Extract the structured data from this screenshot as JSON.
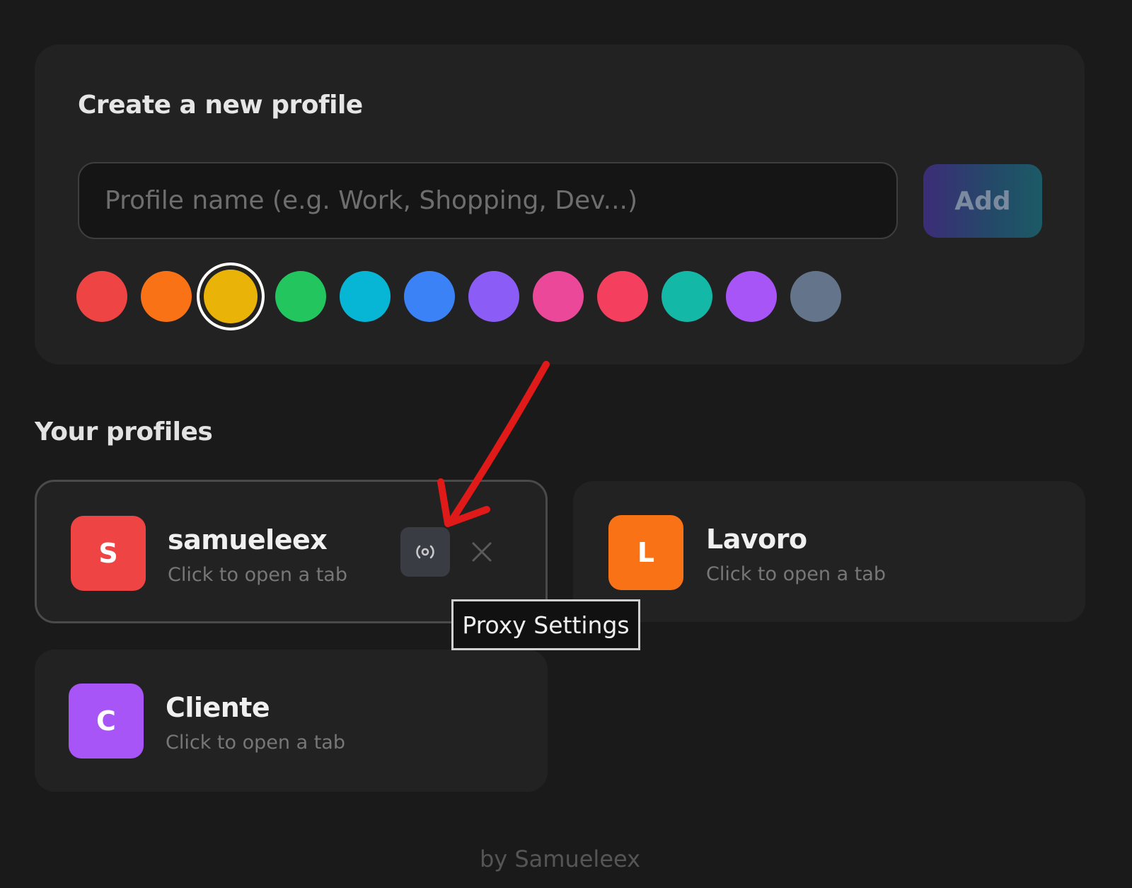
{
  "create": {
    "title": "Create a new profile",
    "input_placeholder": "Profile name (e.g. Work, Shopping, Dev...)",
    "input_value": "",
    "add_label": "Add",
    "colors": [
      "#ef4444",
      "#f97316",
      "#eab308",
      "#22c55e",
      "#06b6d4",
      "#3b82f6",
      "#8b5cf6",
      "#ec4899",
      "#f43f5e",
      "#14b8a6",
      "#a855f7",
      "#64748b"
    ],
    "selected_color": "#eab308"
  },
  "profiles_section": {
    "title": "Your profiles",
    "items": [
      {
        "initial": "S",
        "name": "samueleex",
        "subtitle": "Click to open a tab",
        "color": "#ef4444"
      },
      {
        "initial": "L",
        "name": "Lavoro",
        "subtitle": "Click to open a tab",
        "color": "#f97316"
      },
      {
        "initial": "C",
        "name": "Cliente",
        "subtitle": "Click to open a tab",
        "color": "#a855f7"
      }
    ]
  },
  "tooltip": {
    "text": "Proxy Settings"
  },
  "footer": {
    "text": "by Samueleex"
  },
  "icons": {
    "proxy": "broadcast-icon",
    "close": "close-icon"
  },
  "annotation_color": "#e01919"
}
